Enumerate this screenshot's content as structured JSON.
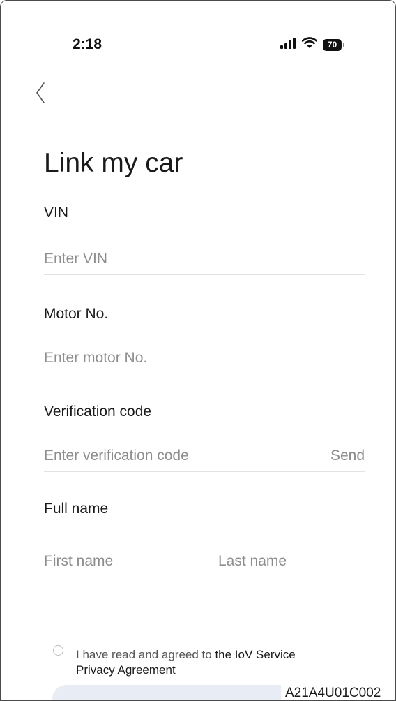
{
  "status_bar": {
    "time": "2:18",
    "battery": "70",
    "icons": [
      "signal-icon",
      "wifi-icon",
      "battery-icon"
    ]
  },
  "nav": {
    "back_icon": "chevron-left-icon"
  },
  "title": "Link my car",
  "vin": {
    "label": "VIN",
    "placeholder": "Enter VIN"
  },
  "motor": {
    "label": "Motor No.",
    "placeholder": "Enter motor No."
  },
  "verification": {
    "label": "Verification code",
    "placeholder": "Enter verification code",
    "send": "Send"
  },
  "full_name": {
    "label": "Full name",
    "first_placeholder": "First name",
    "last_placeholder": "Last name"
  },
  "agreement": {
    "prefix": "I have read and agreed to ",
    "link": "the IoV Service Privacy Agreement"
  },
  "figure_code": "A21A4U01C002"
}
